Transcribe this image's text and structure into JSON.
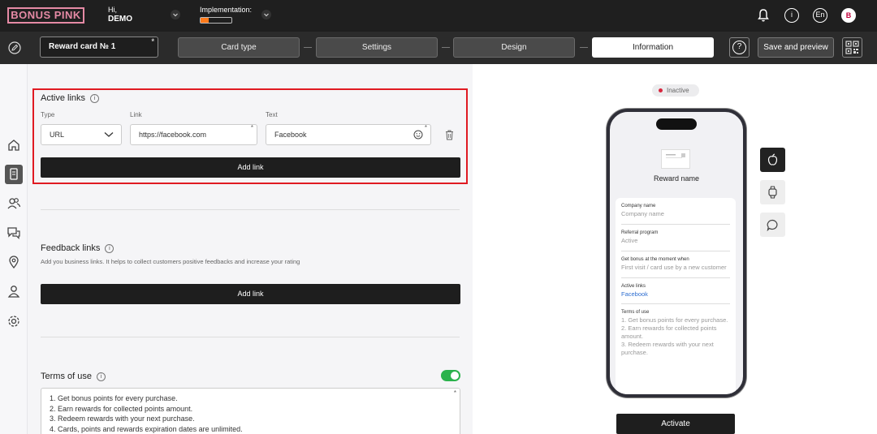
{
  "header": {
    "logo": "BONUS PINK",
    "greeting": "Hi,",
    "username": "DEMO",
    "implementation_label": "Implementation:",
    "implementation_progress": 0.25,
    "language": "En",
    "avatar_letter": "B",
    "info_glyph": "i"
  },
  "toolbar": {
    "card_name": "Reward card № 1",
    "required_mark": "*",
    "steps": [
      {
        "label": "Card type",
        "active": false
      },
      {
        "label": "Settings",
        "active": false
      },
      {
        "label": "Design",
        "active": false
      },
      {
        "label": "Information",
        "active": true
      }
    ],
    "help_glyph": "?",
    "save_label": "Save and preview"
  },
  "active_links": {
    "title": "Active links",
    "info_glyph": "i",
    "type_label": "Type",
    "link_label": "Link",
    "text_label": "Text",
    "type_value": "URL",
    "link_value": "https://facebook.com",
    "text_value": "Facebook",
    "required_mark": "*",
    "add_label": "Add link"
  },
  "feedback_links": {
    "title": "Feedback links",
    "info_glyph": "i",
    "description": "Add you business links. It helps to collect customers positive feedbacks and increase your rating",
    "add_label": "Add link"
  },
  "terms": {
    "title": "Terms of use",
    "info_glyph": "i",
    "enabled": true,
    "required_mark": "*",
    "lines": [
      "1. Get bonus points for every purchase.",
      "2. Earn rewards for collected points amount.",
      "3. Redeem rewards with your next purchase.",
      "4. Cards, points and rewards expiration dates are unlimited."
    ]
  },
  "preview": {
    "status": "Inactive",
    "reward_name": "Reward name",
    "fields": [
      {
        "label": "Company name",
        "value": "Company name",
        "link": false
      },
      {
        "label": "Referral program",
        "value": "Active",
        "link": false
      },
      {
        "label": "Get bonus at the moment when",
        "value": "First visit / card use by a new customer",
        "link": false
      },
      {
        "label": "Active links",
        "value": "Facebook",
        "link": true
      },
      {
        "label": "Terms of use",
        "value": "1. Get bonus points for every purchase.\n2. Earn rewards for collected points amount.\n3. Redeem rewards with your next purchase.",
        "link": false
      }
    ],
    "activate_label": "Activate"
  },
  "colors": {
    "accent_pink": "#e58aa5",
    "highlight_red": "#e01a22",
    "toggle_green": "#2bb24c",
    "link_blue": "#2f6fd1",
    "progress_orange": "#ff7a1a",
    "inactive_dot": "#d7263d"
  },
  "icons": {
    "top": [
      "bell-icon",
      "info-icon",
      "language-icon",
      "avatar"
    ],
    "sidebar": [
      "home-icon",
      "card-icon",
      "users-icon",
      "chat-icon",
      "location-icon",
      "profile-icon",
      "settings-icon"
    ],
    "platforms": [
      "apple-icon",
      "watch-icon",
      "chat-bubble-icon"
    ]
  }
}
